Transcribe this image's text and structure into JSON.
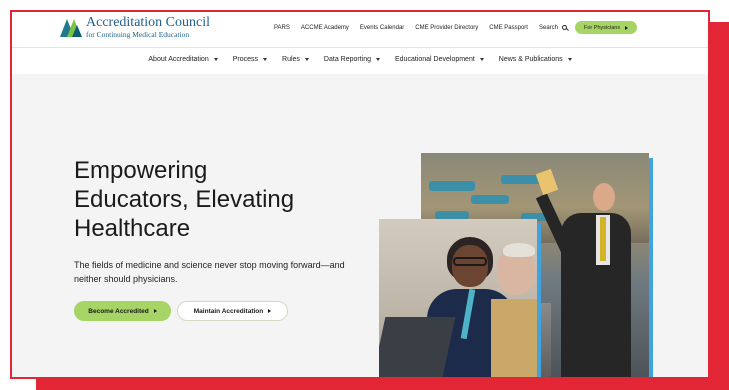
{
  "brand": {
    "title": "Accreditation Council",
    "subtitle": "for Continuing Medical Education",
    "colors": {
      "accent_red": "#e32636",
      "accent_green": "#a6d465",
      "brand_blue": "#1f5f8b",
      "photo_border": "#3fa3e0"
    }
  },
  "utility_nav": {
    "links": [
      "PARS",
      "ACCME Academy",
      "Events Calendar",
      "CME Provider Directory",
      "CME Passport"
    ],
    "search_label": "Search",
    "search_icon": "magnifier-icon",
    "cta_label": "For Physicians"
  },
  "main_nav": {
    "items": [
      "About Accreditation",
      "Process",
      "Rules",
      "Data Reporting",
      "Educational Development",
      "News & Publications"
    ]
  },
  "hero": {
    "title_lines": [
      "Empowering",
      "Educators, Elevating",
      "Healthcare"
    ],
    "body": "The fields of medicine and science never stop moving forward—and neither should physicians.",
    "primary_button": "Become Accredited",
    "secondary_button": "Maintain Accreditation"
  }
}
